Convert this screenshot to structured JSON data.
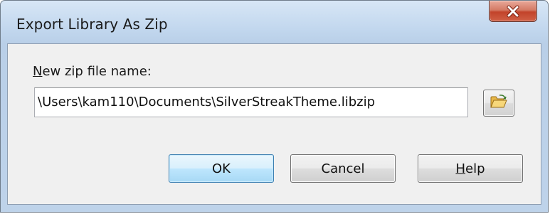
{
  "window": {
    "title": "Export Library As Zip"
  },
  "titlebar": {
    "close_icon": "close-x-icon",
    "close_color": "#c2432a"
  },
  "form": {
    "label_mnemonic": "N",
    "label_rest": "ew zip file name:",
    "path_value": "\\Users\\kam110\\Documents\\SilverStreakTheme.libzip",
    "browse_icon": "open-folder-icon"
  },
  "buttons": {
    "ok_label": "OK",
    "cancel_label": "Cancel",
    "help_mnemonic": "H",
    "help_rest": "elp"
  },
  "colors": {
    "default_button_border": "#3c7fb1",
    "frame": "#bed3ea"
  }
}
